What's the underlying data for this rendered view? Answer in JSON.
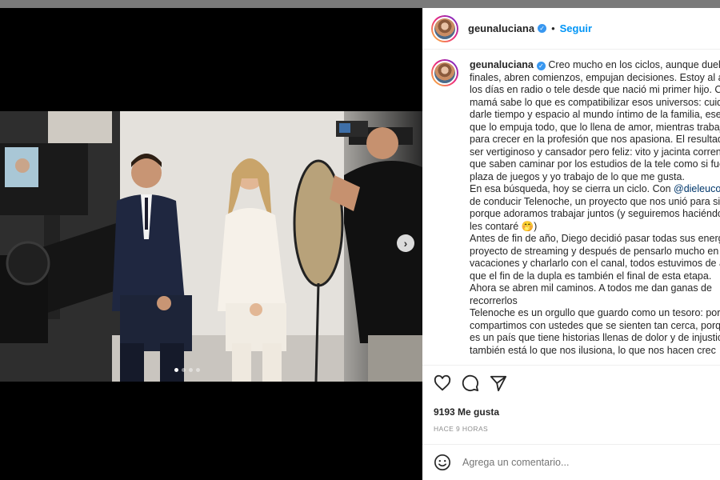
{
  "post": {
    "username": "geunaluciana",
    "follow_label": "Seguir",
    "separator": "•",
    "verified_icon": "verified-badge-icon",
    "caption_lines": [
      "Creo mucho en los ciclos, aunque duelan",
      "finales, abren comienzos, empujan decisiones. Estoy al aire",
      "los días en radio o tele desde que nació mi primer hijo. Cu",
      "mamá sabe lo que es compatibilizar esos universos: cuida",
      "darle tiempo y espacio al mundo íntimo de la familia, ese",
      "que lo empuja todo, que lo llena de amor, mientras trabaj",
      "para crecer en la profesión que nos apasiona. El resultado",
      "ser vertiginoso y cansador pero feliz: vito y jacinta corren",
      "que saben caminar por los estudios de la tele como si fuer",
      "plaza de juegos y yo trabajo de lo que me gusta.",
      "En esa búsqueda, hoy se cierra un ciclo. Con ",
      "de conducir Telenoche, un proyecto que nos unió para sie",
      "porque adoramos trabajar juntos (y seguiremos haciéndol",
      "les contaré 🤭)",
      "Antes de fin de año, Diego decidió pasar todas sus energí",
      "proyecto de streaming y después de pensarlo mucho en n",
      "vacaciones y charlarlo con el canal, todos estuvimos de ac",
      "que el fin de la dupla es también el final de esta etapa.",
      "Ahora se abren mil caminos. A todos me dan ganas de",
      "recorrerlos",
      "Telenoche es un orgullo que guardo como un tesoro: porq",
      "compartimos con ustedes que se sienten tan cerca, porqu",
      "es un país que tiene historias llenas de dolor y de injusticia",
      "también está lo que nos ilusiona, lo que nos hacen crec"
    ],
    "mention": "@dieleuco",
    "mention_suffix": " de",
    "likes": "9193 Me gusta",
    "time_ago": "HACE 9 HORAS",
    "comment_placeholder": "Agrega un comentario..."
  },
  "icons": {
    "like": "heart-icon",
    "comment": "comment-icon",
    "share": "paper-plane-icon",
    "emoji": "emoji-icon",
    "next": "chevron-right-icon"
  },
  "carousel": {
    "slides": 4,
    "active_index": 0
  },
  "colors": {
    "link": "#0095f6",
    "mention": "#00376b",
    "text": "#262626",
    "muted": "#8e8e8e"
  }
}
